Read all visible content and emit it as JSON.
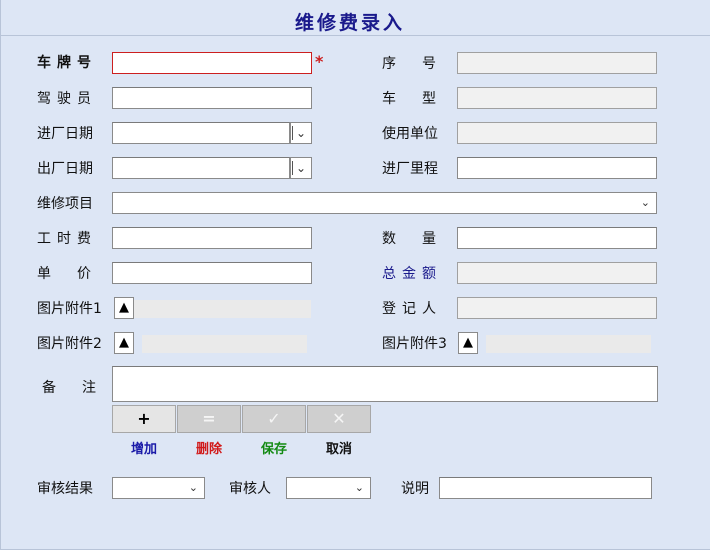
{
  "page": {
    "title": "维修费录入"
  },
  "form": {
    "plate_label": "车牌号",
    "seq_label": "序号",
    "driver_label": "驾驶员",
    "vehicle_type_label": "车型",
    "entry_date_label": "进厂日期",
    "unit_label": "使用单位",
    "exit_date_label": "出厂日期",
    "entry_mileage_label": "进厂里程",
    "item_label": "维修项目",
    "labor_label": "工时费",
    "qty_label": "数量",
    "price_label": "单价",
    "total_label": "总金额",
    "attach1_label": "图片附件1",
    "recorder_label": "登记人",
    "attach2_label": "图片附件2",
    "attach3_label": "图片附件3",
    "note_label": "备注",
    "required_mark": "*"
  },
  "toolbar": {
    "add_icon": "+",
    "add_label": "增加",
    "add_color": "#1a1aa8",
    "delete_icon": "=",
    "delete_label": "删除",
    "delete_color": "#d11a1a",
    "save_icon": "✓",
    "save_label": "保存",
    "save_color": "#138a13",
    "cancel_icon": "✕",
    "cancel_label": "取消",
    "cancel_color": "#111111"
  },
  "review": {
    "result_label": "审核结果",
    "reviewer_label": "审核人",
    "desc_label": "说明"
  },
  "icons": {
    "upload": "▲",
    "dropdown": "⌄",
    "spin": "⌄"
  }
}
